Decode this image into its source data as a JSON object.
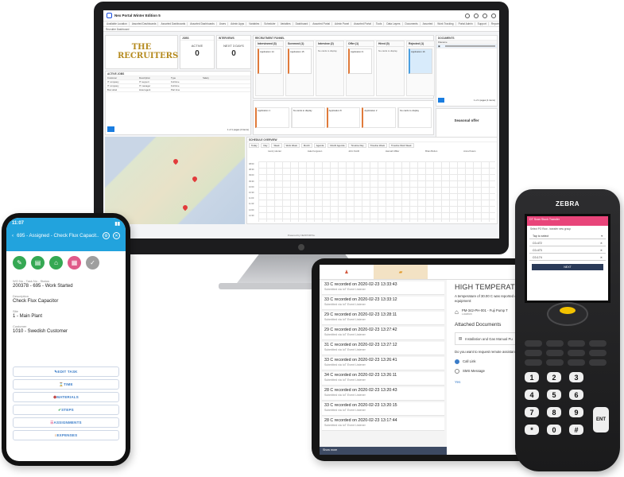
{
  "monitor": {
    "app_title": "Nex Portal Winter Edition 5",
    "tabs": [
      "Available Location",
      "Assorted Dashboards",
      "Assorted Dashboards",
      "Assorted Dashboards",
      "Users",
      "Admin Apps",
      "Variables",
      "Scheduler",
      "Variables",
      "Dashboard",
      "Assorted Portal",
      "Admin Panel",
      "Assorted Portal",
      "Tools",
      "Data Layers",
      "Documents",
      "Assorted",
      "Work Tracking",
      "Portal Admin",
      "Support",
      "Reports",
      "Import",
      "Export"
    ],
    "subtitle": "Recruiter Dashboard",
    "brand_text": "THE RECRUITERS",
    "kpis": [
      {
        "label": "ACTIVE",
        "value": "0"
      },
      {
        "label": "NEXT 3 DAYS",
        "value": "0"
      }
    ],
    "kpi_headers": [
      "JOBS",
      "INTERVIEWS"
    ],
    "pipeline_title": "RECRUITMENT FUNNEL",
    "pipeline_cols": [
      {
        "title": "Interviewed (3)",
        "text": "Application 14"
      },
      {
        "title": "Screened (1)",
        "text": "Application 15"
      },
      {
        "title": "Interview (2)",
        "text": "No cards to display"
      },
      {
        "title": "Offer (1)",
        "text": "Application 9"
      },
      {
        "title": "Hired (0)",
        "text": "No cards to display"
      },
      {
        "title": "Rejected (1)",
        "text": "Application 16"
      }
    ],
    "pipeline_bottom": [
      "Application 1",
      "No cards to display",
      "Application 8",
      "Application 2",
      "No cards to display"
    ],
    "documents_title": "DOCUMENTS",
    "documents_header": "Filename",
    "documents_footer": "1 of 1 pages (1 items)",
    "offer_title": "Seasonal offer",
    "active_jobs_title": "ACTIVE JOBS",
    "jobs_table_headers": [
      "Customer",
      "Description",
      "Type",
      "Salary"
    ],
    "jobs_rows": [
      [
        "IT company",
        "IT support",
        "Full time",
        ""
      ],
      [
        "IT company",
        "IT manager",
        "Full time",
        ""
      ],
      [
        "Bus Hotel",
        "Hotel agent",
        "Part time",
        ""
      ]
    ],
    "jobs_footer": "1 of 1 pages (3 items)",
    "calendar_title": "SCHEDULE OVERVIEW",
    "calendar_toolbar": [
      "Today",
      "Day",
      "Week",
      "Work Week",
      "Month",
      "Agenda",
      "Month Agenda",
      "Timeline Day",
      "Timeline Week",
      "Timeline Work Week"
    ],
    "calendar_people": [
      "Henry Hunter",
      "Jake Ferguson",
      "John Smith",
      "Hannah Miller",
      "Brian Bolton",
      "Anna Peters"
    ],
    "calendar_times": [
      "08:00",
      "08:30",
      "09:00",
      "09:30",
      "10:00",
      "10:30",
      "11:00",
      "11:30",
      "12:00",
      "12:30"
    ],
    "footer_text": "Powered by NEXPORTAL"
  },
  "phone": {
    "time": "11:07",
    "title": "695 - Assigned - Check Flux Capacit...",
    "field1_label": "WO No - Task No - Status",
    "field1_value": "200378 - 695 - Work Started",
    "field2_label": "Description",
    "field2_value": "Check Flux Capacitor",
    "field3_label": "Site",
    "field3_value": "1 - Main Plant",
    "field4_label": "Customer",
    "field4_value": "1010 - Swedish Customer",
    "buttons": [
      "EDIT TASK",
      "TIME",
      "MATERIALS",
      "STEPS",
      "ASSIGNMENTS",
      "EXPENSES"
    ],
    "chip_colors": [
      "#35a853",
      "#35a853",
      "#35a853",
      "#e05a8a",
      "#9e9e9e"
    ]
  },
  "tablet": {
    "events": [
      {
        "title": "33 C recorded on 2020-02-23 13:33:43",
        "sub": "Submitted via IoT Event Listener"
      },
      {
        "title": "33 C recorded on 2020-02-23 13:33:12",
        "sub": "Submitted via IoT Event Listener"
      },
      {
        "title": "29 C recorded on 2020-02-23 13:28:11",
        "sub": "Submitted via IoT Event Listener"
      },
      {
        "title": "29 C recorded on 2020-02-23 13:27:42",
        "sub": "Submitted via IoT Event Listener"
      },
      {
        "title": "31 C recorded on 2020-02-23 13:27:12",
        "sub": "Submitted via IoT Event Listener"
      },
      {
        "title": "33 C recorded on 2020-02-23 13:26:41",
        "sub": "Submitted via IoT Event Listener"
      },
      {
        "title": "34 C recorded on 2020-02-23 13:26:11",
        "sub": "Submitted via IoT Event Listener"
      },
      {
        "title": "28 C recorded on 2020-02-23 13:20:43",
        "sub": "Submitted via IoT Event Listener"
      },
      {
        "title": "33 C recorded on 2020-02-23 13:20:15",
        "sub": "Submitted via IoT Event Listener"
      },
      {
        "title": "28 C recorded on 2020-02-23 13:17:44",
        "sub": "Submitted via IoT Event Listener"
      }
    ],
    "footer": "Show more",
    "heading": "HIGH TEMPERATURE RE",
    "paragraph": "A temperature of 30.00 C was reported on equipment:",
    "asset_text": "PM-342-PH-001 - Fuji Pump T",
    "asset_sub": "Location",
    "attached_title": "Attached Documents",
    "doc_name": "Installation and Gas Manual Pu",
    "question": "Do you want to request remote assistance for",
    "options": [
      "Call Link",
      "SMS Message"
    ],
    "yes_label": "Yes"
  },
  "scanner": {
    "brand": "ZEBRA",
    "header_text": "DT Scan Stock Transfer",
    "sub_header": "Select PO Row - transfer new group",
    "tap_label": "Tap to select",
    "rows": [
      {
        "label": "C0-472",
        "mark": "✕"
      },
      {
        "label": "C0-473",
        "mark": "✕"
      },
      {
        "label": "C0-174",
        "mark": "✕"
      }
    ],
    "next_label": "NEXT",
    "keys": [
      "1",
      "2",
      "3",
      "4",
      "5",
      "6",
      "7",
      "8",
      "9",
      "*",
      "0",
      "#"
    ],
    "ent_label": "ENT"
  }
}
